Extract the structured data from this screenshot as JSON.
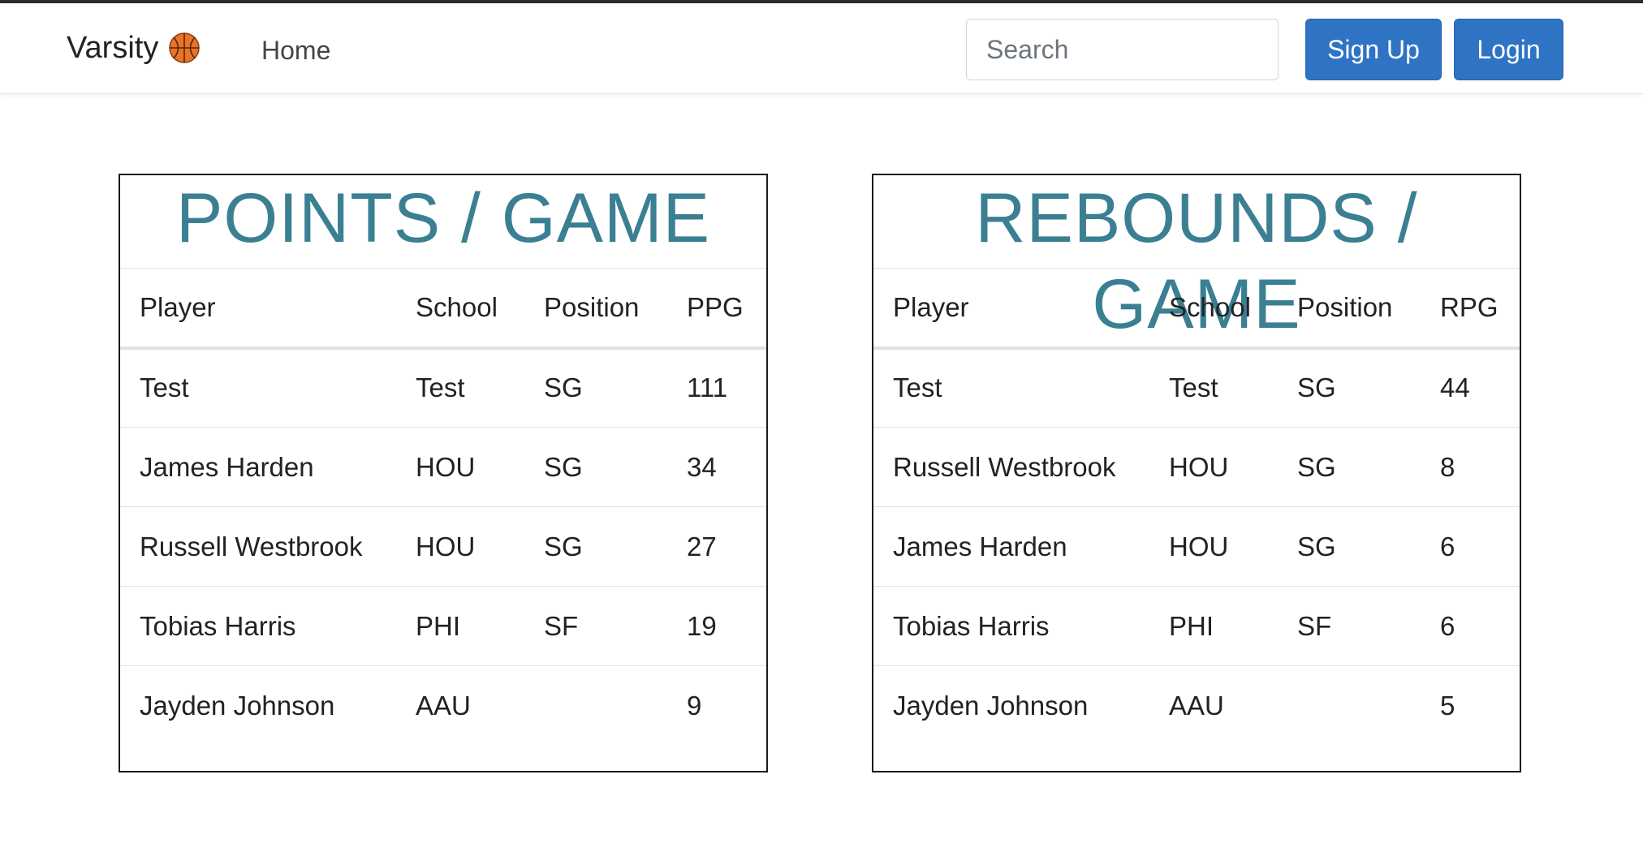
{
  "nav": {
    "brand": "Varsity",
    "brand_icon": "basketball-icon",
    "home": "Home",
    "search_placeholder": "Search",
    "signup": "Sign Up",
    "login": "Login"
  },
  "ppg": {
    "title": "POINTS / GAME",
    "headers": [
      "Player",
      "School",
      "Position",
      "PPG"
    ],
    "rows": [
      [
        "Test",
        "Test",
        "SG",
        "111"
      ],
      [
        "James Harden",
        "HOU",
        "SG",
        "34"
      ],
      [
        "Russell Westbrook",
        "HOU",
        "SG",
        "27"
      ],
      [
        "Tobias Harris",
        "PHI",
        "SF",
        "19"
      ],
      [
        "Jayden Johnson",
        "AAU",
        "",
        "9"
      ]
    ]
  },
  "rpg": {
    "title": "REBOUNDS / GAME",
    "headers": [
      "Player",
      "School",
      "Position",
      "RPG"
    ],
    "rows": [
      [
        "Test",
        "Test",
        "SG",
        "44"
      ],
      [
        "Russell Westbrook",
        "HOU",
        "SG",
        "8"
      ],
      [
        "James Harden",
        "HOU",
        "SG",
        "6"
      ],
      [
        "Tobias Harris",
        "PHI",
        "SF",
        "6"
      ],
      [
        "Jayden Johnson",
        "AAU",
        "",
        "5"
      ]
    ]
  },
  "colors": {
    "accent": "#3b7f93",
    "button": "#2f73c4"
  }
}
